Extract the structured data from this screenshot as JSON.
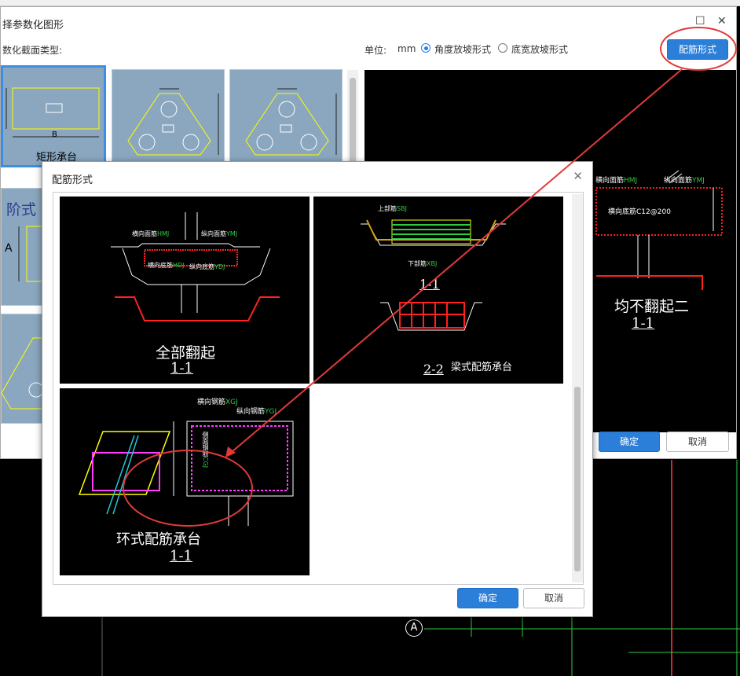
{
  "main_dialog": {
    "title": "择参数化图形",
    "section_label": "数化截面类型:",
    "unit_label": "单位:",
    "unit_value": "mm",
    "radio_angle": "角度放坡形式",
    "radio_width": "底宽放坡形式",
    "rebar_form_button": "配筋形式",
    "ok_button": "确定",
    "cancel_button": "取消",
    "thumbs": [
      {
        "label": "矩形承台"
      },
      {
        "label": "阶式"
      }
    ],
    "preview": {
      "label_heng": "横向面筋",
      "code_heng": "HMJ",
      "label_zong": "纵向面筋",
      "code_zong": "YMJ",
      "label_heng_di": "横向底筋",
      "code_di": "C12@200",
      "caption": "均不翻起二",
      "section": "1-1"
    }
  },
  "rebar_dialog": {
    "title": "配筋形式",
    "ok_button": "确定",
    "cancel_button": "取消",
    "tiles": [
      {
        "caption": "全部翻起",
        "section": "1-1",
        "labels": {
          "heng_mian": "横向面筋",
          "zong_mian": "纵向面筋",
          "heng_di": "横向底筋",
          "zong_di": "纵向底筋"
        }
      },
      {
        "caption": "梁式配筋承台",
        "section_top": "1-1",
        "section_bottom": "2-2",
        "labels": {
          "shang": "上部筋",
          "xia": "下部筋"
        }
      },
      {
        "caption": "环式配筋承台",
        "section": "1-1",
        "labels": {
          "heng": "横向钢筋",
          "heng_code": "XGJ",
          "zong": "纵向钢筋",
          "zong_code": "YGJ",
          "ce": "侧面钢筋",
          "ce_code": "CGJ"
        }
      }
    ]
  },
  "cad": {
    "axis_label": "A"
  },
  "colors": {
    "accent": "#2b7fd9",
    "annotation": "#e23a3a",
    "cad_green": "#2ecc40",
    "cad_red": "#ff2020"
  }
}
